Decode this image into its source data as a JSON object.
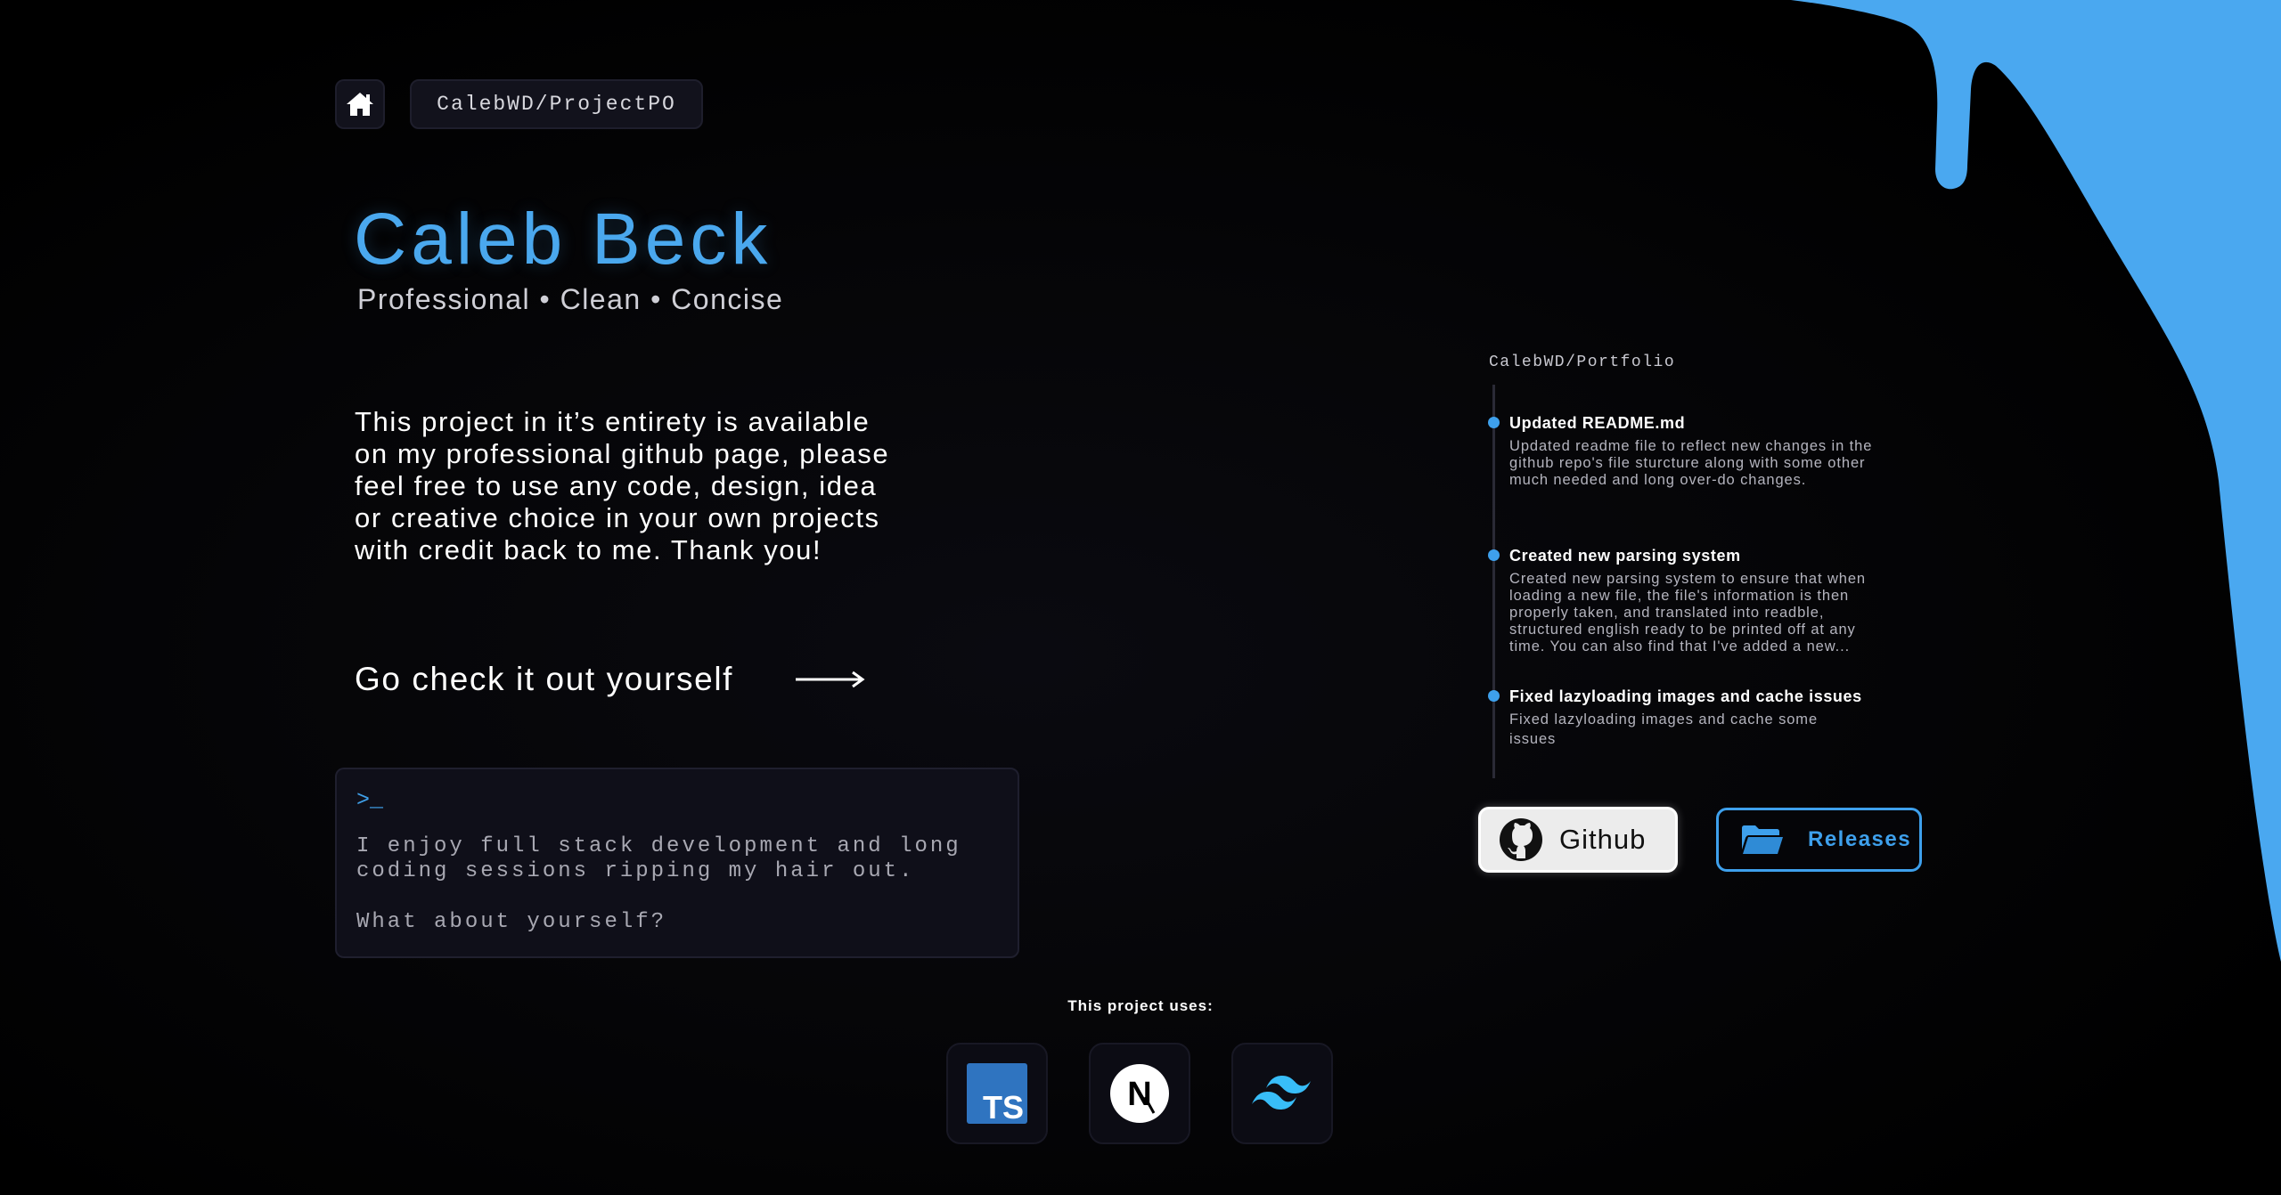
{
  "colors": {
    "accent": "#3EA0EC",
    "background": "#000000",
    "blob": "#4AA8F0",
    "terminal_bg": "#0F0F19",
    "typescript": "#2F74C0",
    "tailwind": "#38BDF8"
  },
  "header": {
    "home_icon": "home-icon",
    "repo_label": "CalebWD/ProjectPO"
  },
  "hero": {
    "name": "Caleb Beck",
    "tagline": "Professional • Clean • Concise",
    "intro_lines": [
      "This project in it’s entirety is available",
      "on my professional github page, please",
      "feel free to use any code, design, idea",
      "or creative choice in your own projects",
      "with credit back to me. Thank you!"
    ],
    "cta_label": "Go check it out yourself",
    "cta_icon": "arrow-right-icon"
  },
  "terminal": {
    "prompt": ">_",
    "lines": [
      "I enjoy full stack development and long",
      "coding sessions ripping my hair out."
    ],
    "question": "What about yourself?"
  },
  "tech": {
    "label": "This project uses:",
    "items": [
      {
        "name": "typescript-icon",
        "text": "TS"
      },
      {
        "name": "nextjs-icon",
        "text": "N"
      },
      {
        "name": "tailwind-icon"
      }
    ]
  },
  "timeline": {
    "repo": "CalebWD/Portfolio",
    "items": [
      {
        "title": "Updated README.md",
        "desc_lines": [
          "Updated readme file to reflect new changes in the",
          "github repo's file sturcture along with some other",
          "much needed and long over-do changes."
        ]
      },
      {
        "title": "Created new parsing system",
        "desc_lines": [
          "Created new parsing system to ensure that when",
          "loading a new file, the file's information is then",
          "properly taken, and translated into readble,",
          "structured english ready to be printed off at any",
          "time. You can also find that I've added a new..."
        ]
      },
      {
        "title": "Fixed lazyloading images and cache issues",
        "desc_lines": [
          "Fixed lazyloading images and cache some",
          "issues"
        ]
      }
    ]
  },
  "actions": {
    "github_label": "Github",
    "github_icon": "github-icon",
    "releases_label": "Releases",
    "releases_icon": "folder-open-icon"
  }
}
